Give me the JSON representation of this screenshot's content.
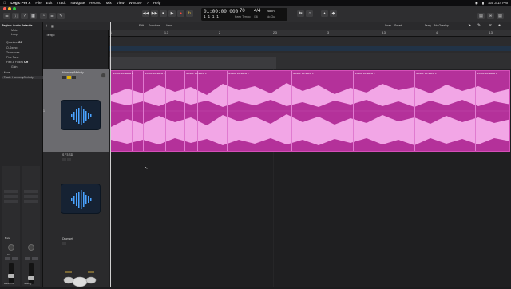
{
  "menubar": {
    "app_name": "Logic Pro X",
    "items": [
      "File",
      "Edit",
      "Track",
      "Navigate",
      "Record",
      "Mix",
      "View",
      "Window",
      "?",
      "Help"
    ],
    "status": [
      "Sat 3:14 PM"
    ]
  },
  "window": {
    "title": "Mix 1 (Untitled) – Mix 1 Tracks"
  },
  "transport": {
    "time": "01:00:00:000",
    "bars": "1  1  1     1",
    "tempo": "70",
    "tempo_label": "Keep Tempo",
    "signature": "4/4",
    "signature_sub": "/16",
    "key": "No In",
    "key_sub": "No Out"
  },
  "inspector": {
    "region_header": "Region: Audio Defaults",
    "rows": [
      {
        "label": "Mute",
        "value": ""
      },
      {
        "label": "Loop",
        "value": ""
      },
      {
        "label": "Quantize",
        "value": "Off"
      },
      {
        "label": "Q-Swing",
        "value": ""
      },
      {
        "label": "Transpose",
        "value": ""
      },
      {
        "label": "Fine Tune",
        "value": ""
      },
      {
        "label": "Flex & Follow",
        "value": "Off"
      },
      {
        "label": "Gain",
        "value": ""
      }
    ],
    "more": "More",
    "track_header": "Track: Harmony/Melody",
    "strip_labels": [
      "Setting",
      "Bnce",
      "Bnce Out"
    ],
    "gain_value": "0.0"
  },
  "area_header": {
    "edit_label": "Edit",
    "functions_label": "Functions",
    "view_label": "View",
    "snap_label": "Snap",
    "snap_value": "Smart",
    "drag_label": "Drag",
    "drag_value": "No Overlap"
  },
  "ruler": {
    "marks": [
      "1",
      "1.3",
      "2",
      "2.3",
      "3",
      "3.3",
      "4",
      "4.3"
    ]
  },
  "globals": {
    "tempo_label": "Tempo"
  },
  "tracks": [
    {
      "name": "Harmony/Melody",
      "number": "1"
    },
    {
      "name": "S F3 SD",
      "number": "2"
    },
    {
      "name": "Drumset",
      "number": "3"
    }
  ],
  "region": {
    "color": "#b4319a",
    "names": [
      "G-DMP 10-SHLH 1",
      "G-DMP 10-SHLH 1",
      "G-DMP 10-SHLH 1",
      "G-DMP 10-SHLH 1",
      "G-DMP 10-SHLH 1",
      "G-DMP 10-SHLH 1",
      "G-DMP 10-SHLH 1",
      "G-DMP 10-SHLH 1",
      "G-DMP 10-SHLH 1",
      "G-DMP 10-SHLH 1"
    ]
  }
}
